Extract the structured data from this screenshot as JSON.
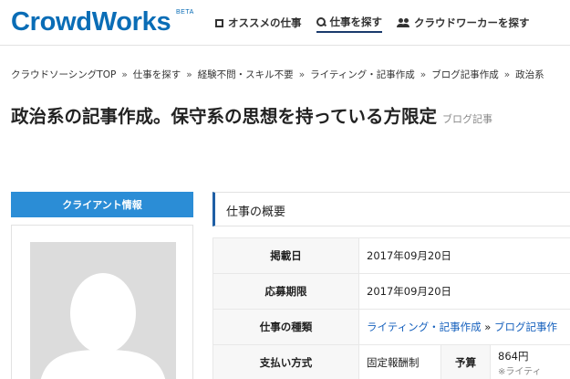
{
  "header": {
    "logo": "CrowdWorks",
    "beta": "BETA",
    "nav": [
      {
        "label": "オススメの仕事"
      },
      {
        "label": "仕事を探す"
      },
      {
        "label": "クラウドワーカーを探す"
      }
    ]
  },
  "breadcrumb": [
    "クラウドソーシングTOP",
    "仕事を探す",
    "経験不問・スキル不要",
    "ライティング・記事作成",
    "ブログ記事作成",
    "政治系"
  ],
  "page": {
    "title": "政治系の記事作成。保守系の思想を持っている方限定",
    "tag": "ブログ記事"
  },
  "client": {
    "header": "クライアント情報"
  },
  "summary": {
    "title": "仕事の概要",
    "rows": {
      "posted_label": "掲載日",
      "posted_value": "2017年09月20日",
      "deadline_label": "応募期限",
      "deadline_value": "2017年09月20日",
      "type_label": "仕事の種類",
      "type_value_1": "ライティング・記事作成",
      "type_sep": "»",
      "type_value_2": "ブログ記事作",
      "payment_label": "支払い方式",
      "payment_value": "固定報酬制",
      "budget_label": "予算",
      "budget_value": "864円",
      "budget_note": "※ライティ"
    }
  },
  "colors": {
    "brand": "#0a6db6",
    "client_header": "#2b8dd6",
    "summary_accent": "#1f5fa5",
    "link": "#1560bd"
  }
}
